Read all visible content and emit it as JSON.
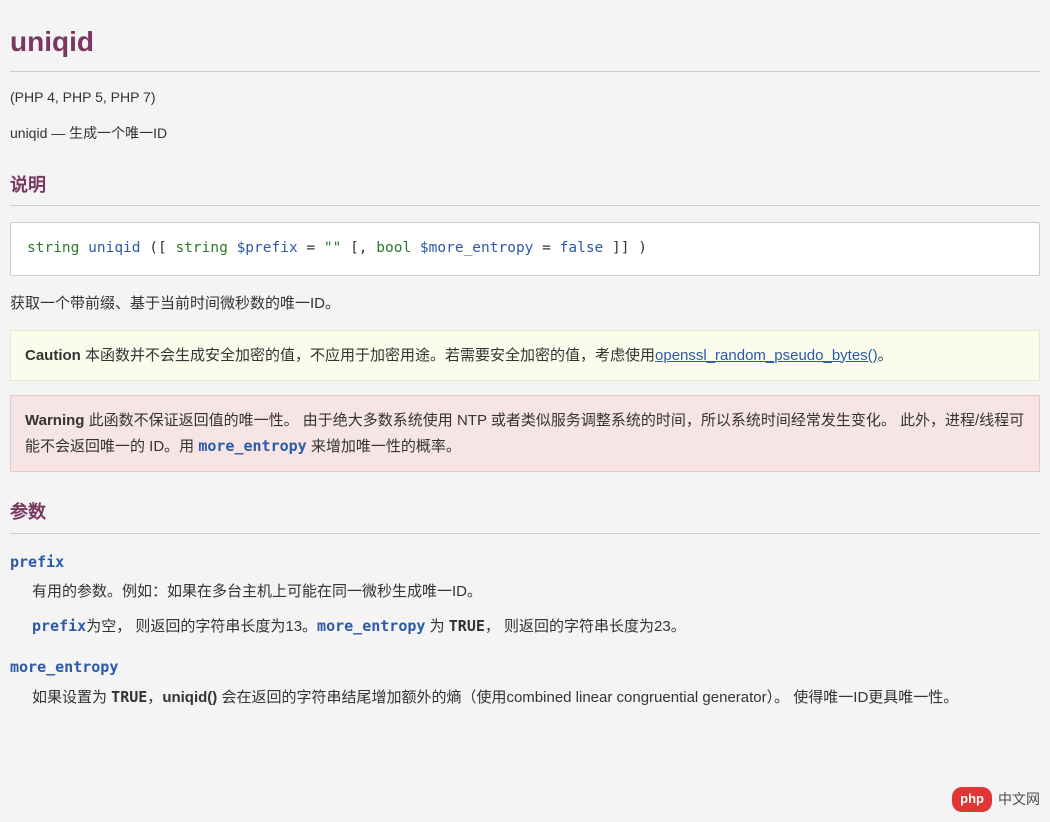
{
  "title": "uniqid",
  "versions": "(PHP 4, PHP 5, PHP 7)",
  "summary_fn": "uniqid",
  "summary_sep": " — ",
  "summary_text": "生成一个唯一ID",
  "sections": {
    "synopsis": "说明",
    "params": "参数"
  },
  "signature": {
    "ret": "string",
    "fn": "uniqid",
    "open": " ([ ",
    "p1_type": "string",
    "p1_var": "$prefix",
    "p1_eq": " = ",
    "p1_def": "\"\"",
    "mid": " [, ",
    "p2_type": "bool",
    "p2_var": "$more_entropy",
    "p2_eq": " = ",
    "p2_def": "false",
    "close": " ]] )"
  },
  "description": "获取一个带前缀、基于当前时间微秒数的唯一ID。",
  "caution": {
    "label": "Caution",
    "text": "本函数并不会生成安全加密的值，不应用于加密用途。若需要安全加密的值，考虑使用",
    "link": "openssl_random_pseudo_bytes()",
    "tail": "。"
  },
  "warning": {
    "label": "Warning",
    "t1": "此函数不保证返回值的唯一性。 由于绝大多数系统使用 NTP 或者类似服务调整系统的时间，所以系统时间经常发生变化。 此外，进程/线程可能不会返回唯一的 ID。用 ",
    "code": "more_entropy",
    "t2": " 来增加唯一性的概率。"
  },
  "params": {
    "prefix": {
      "name": "prefix",
      "d1": "有用的参数。例如：如果在多台主机上可能在同一微秒生成唯一ID。",
      "d2a": "为空， 则返回的字符串长度为13。",
      "code1": "prefix",
      "code2": "more_entropy",
      "d2b": " 为 ",
      "const": "TRUE",
      "d2c": "， 则返回的字符串长度为23。"
    },
    "more_entropy": {
      "name": "more_entropy",
      "t1": "如果设置为 ",
      "const": "TRUE",
      "t2": "，",
      "fn": "uniqid()",
      "t3": " 会在返回的字符串结尾增加额外的熵（使用combined linear congruential generator）。 使得唯一ID更具唯一性。"
    }
  },
  "watermark": {
    "logo": "php",
    "text": "中文网"
  }
}
